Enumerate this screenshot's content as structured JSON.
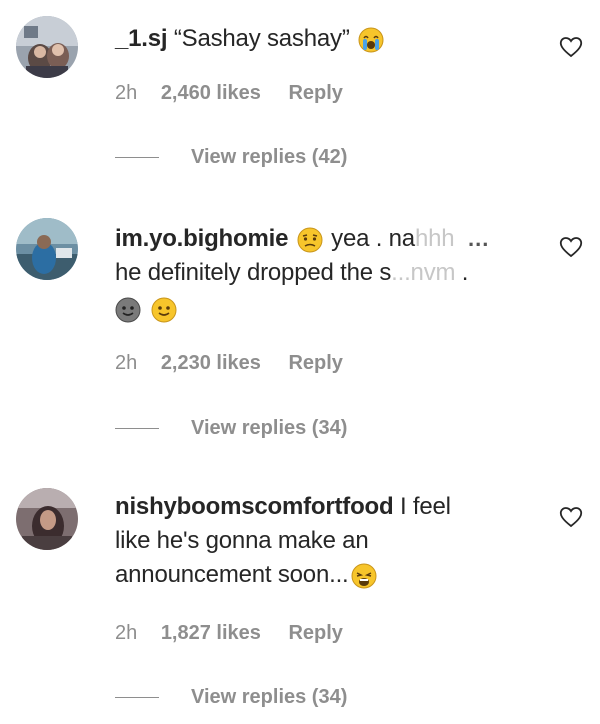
{
  "comments": [
    {
      "username": "_1.sj",
      "text_before": "“Sashay sashay”",
      "emoji": "crying-emoji",
      "time": "2h",
      "likes": "2,460 likes",
      "reply": "Reply",
      "view_replies": "View replies (42)"
    },
    {
      "username": "im.yo.bighomie",
      "emoji_after_name": "confused-emoji",
      "text_line1": "yea . na",
      "text_line1_faded": "hhh",
      "text_line2": "he definitely dropped the s",
      "text_line2_faded": "...nvm",
      "text_line2_end": " .",
      "emoji_line3": [
        "gray-smile-emoji",
        "smile-emoji"
      ],
      "more": "...",
      "time": "2h",
      "likes": "2,230 likes",
      "reply": "Reply",
      "view_replies": "View replies (34)"
    },
    {
      "username": "nishyboomscomfortfood",
      "text_line1": "I feel",
      "text_line2": "like he's gonna make an",
      "text_line3": "announcement soon...",
      "emoji": "weary-emoji",
      "time": "2h",
      "likes": "1,827 likes",
      "reply": "Reply",
      "view_replies": "View replies (34)"
    }
  ],
  "colors": {
    "text": "#262626",
    "meta": "#8e8e8e",
    "faded": "#c7c7c7",
    "emoji_yellow": "#f7c52b"
  }
}
